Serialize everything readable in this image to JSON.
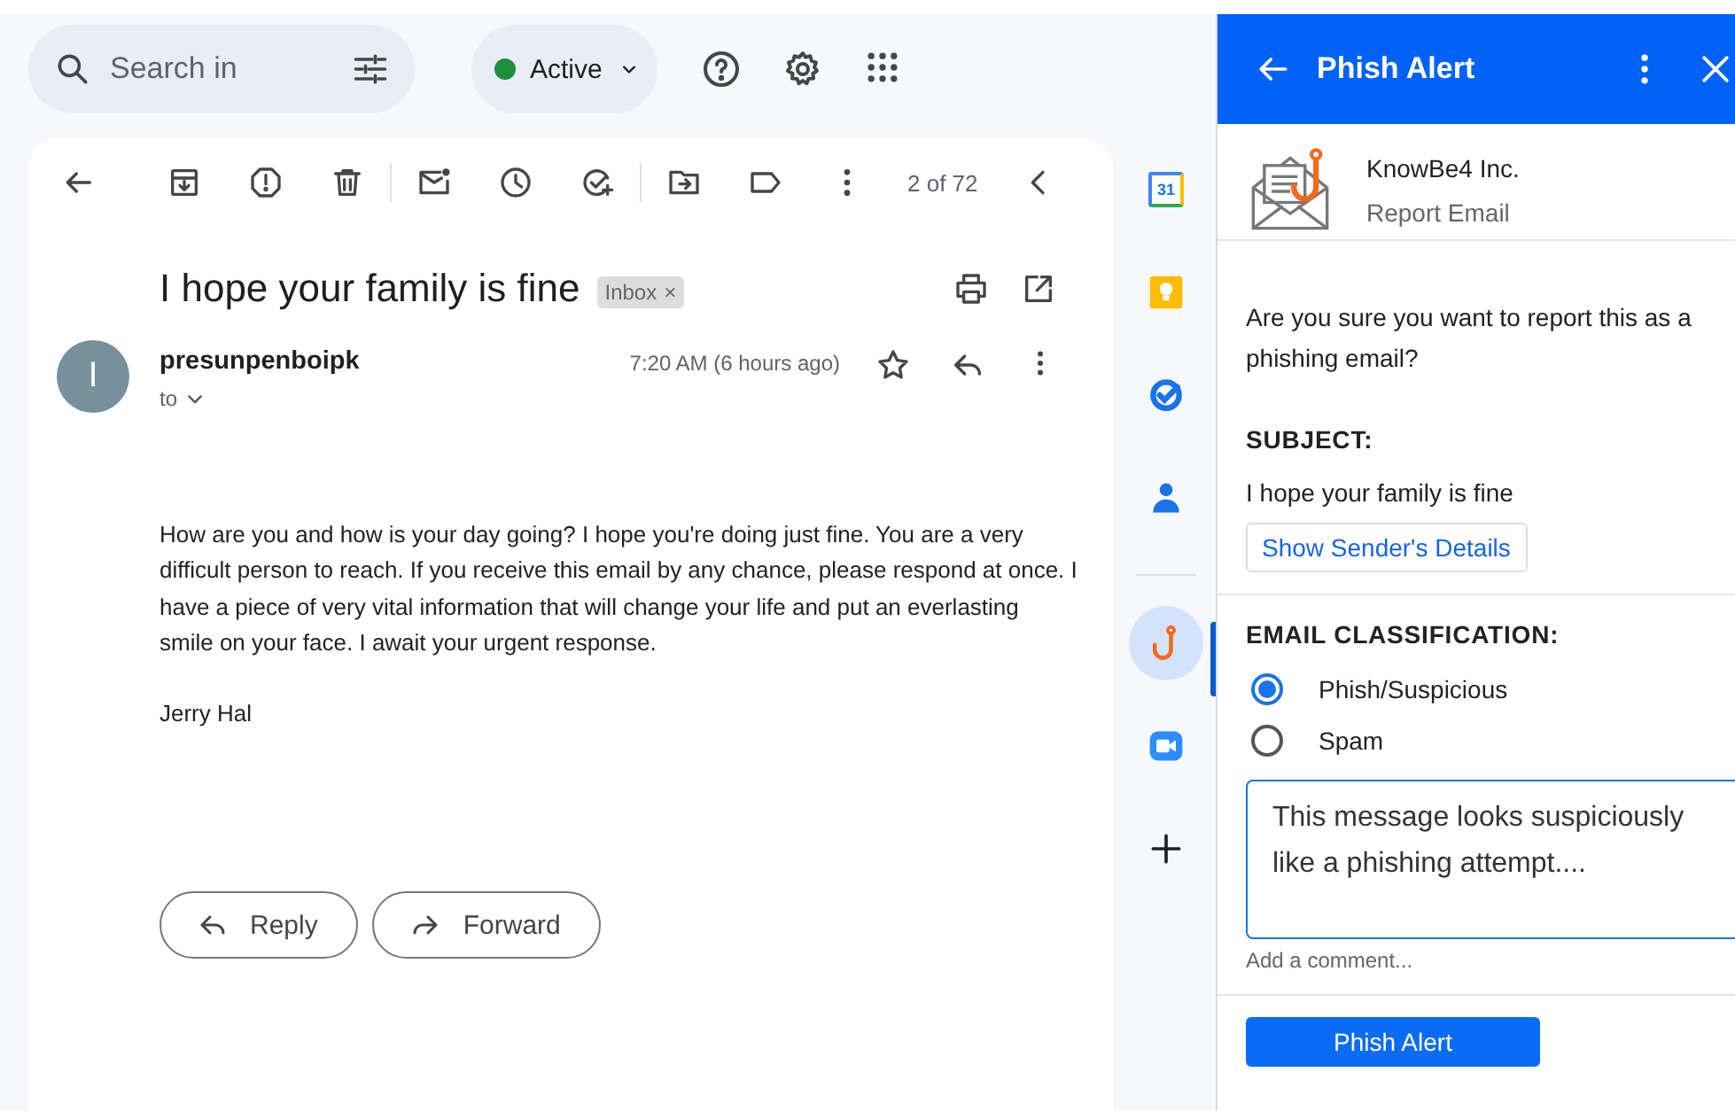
{
  "search": {
    "placeholder": "Search in"
  },
  "status": {
    "label": "Active"
  },
  "toolbar": {
    "counter": "2 of 72"
  },
  "email": {
    "subject": "I hope your family is fine",
    "label": {
      "text": "Inbox",
      "remove": "×"
    },
    "avatar": "I",
    "sender": "presunpenboipk",
    "recipient": "to",
    "time": "7:20 AM (6 hours ago)",
    "body": [
      "How are you and how is your day going? I hope you're doing just fine. You are a very difficult person to reach. If you receive this email by any chance, please respond at once. I have a piece of very vital information that will change your life and put an everlasting smile on your face. I await your urgent response.",
      "Jerry Hal"
    ],
    "actions": [
      {
        "kind": "reply",
        "label": "Reply"
      },
      {
        "kind": "forward",
        "label": "Forward"
      }
    ]
  },
  "rail": [
    {
      "kind": "calendar",
      "label": "31",
      "selected": false
    },
    {
      "kind": "keep",
      "selected": false
    },
    {
      "kind": "tasks",
      "selected": false
    },
    {
      "kind": "contacts",
      "selected": false
    },
    {
      "kind": "divider"
    },
    {
      "kind": "phish",
      "selected": true
    },
    {
      "kind": "meet",
      "selected": false
    },
    {
      "kind": "add",
      "selected": false
    }
  ],
  "panel": {
    "title": "Phish Alert",
    "vendor": "KnowBe4 Inc.",
    "subtitle": "Report Email",
    "question": "Are you sure you want to report this as a phishing email?",
    "subject_label": "SUBJECT:",
    "subject": "I hope your family is fine",
    "details_button": "Show Sender's Details",
    "classification_label": "EMAIL CLASSIFICATION:",
    "options": [
      {
        "label": "Phish/Suspicious",
        "selected": true
      },
      {
        "label": "Spam",
        "selected": false
      }
    ],
    "comment": "This message looks suspiciously like a phishing attempt....",
    "comment_hint": "Add a comment...",
    "submit": "Phish Alert"
  }
}
